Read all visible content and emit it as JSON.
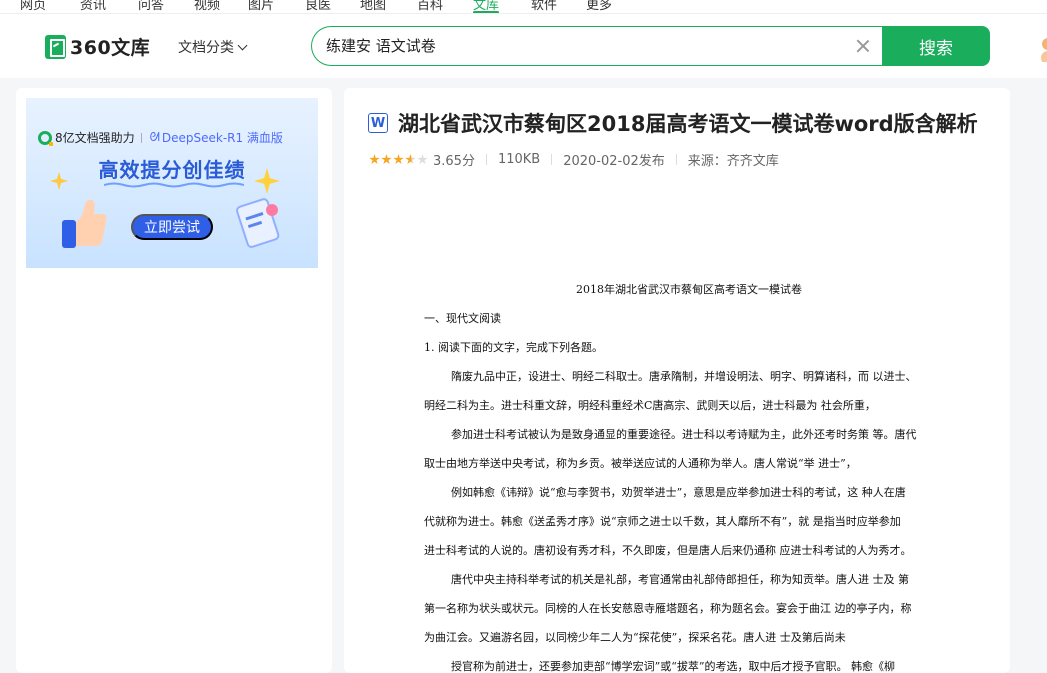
{
  "topnav": {
    "items": [
      "网页",
      "资讯",
      "问答",
      "视频",
      "图片",
      "良医",
      "地图",
      "百科",
      "文库",
      "软件",
      "更多"
    ],
    "active_index": 8
  },
  "header": {
    "logo_text": "360文库",
    "doc_category_label": "文档分类",
    "search_value": "练建安 语文试卷",
    "search_button_label": "搜索"
  },
  "banner": {
    "tagline": "8亿文档强助力",
    "deepseek_label": "DeepSeek-R1 满血版",
    "headline": "高效提分创佳绩",
    "cta_label": "立即尝试"
  },
  "document": {
    "format_icon_letter": "W",
    "title": "湖北省武汉市蔡甸区2018届高考语文一模试卷word版含解析",
    "rating": 3.65,
    "rating_text": "3.65分",
    "size": "110KB",
    "published": "2020-02-02发布",
    "source": "来源：齐齐文库",
    "lines": [
      "2018年湖北省武汉市蔡甸区高考语文一模试卷",
      "一、现代文阅读",
      "1.  阅读下面的文字，完成下列各题。",
      "隋废九品中正，设进士、明经二科取士。唐承隋制，并增设明法、明字、明算诸科，而 以进士、",
      "明经二科为主。进士科重文辞，明经科重经术C唐高宗、武则天以后，进士科最为 社会所重，",
      "参加进士科考试被认为是致身通显的重要途径。进士科以考诗赋为主，此外还考时务策 等。唐代",
      "取士由地方举送中央考试，称为乡贡。被举送应试的人通称为举人。唐人常说“举 进士”，",
      "例如韩愈《讳辩》说“愈与李贺书，劝贺举进士”，意思是应举参加进士科的考试，这 种人在唐",
      "代就称为进士。韩愈《送孟秀才序》说“京师之进士以千数，其人靡所不有”，就 是指当时应举参加",
      "进士科考试的人说的。唐初设有秀才科，不久即废，但是唐人后来仍通称 应进士科考试的人为秀才。",
      "唐代中央主持科举考试的机关是礼部，考官通常由礼部侍郎担任，称为知贡举。唐人进 士及 第",
      "第一名称为状头或状元。同榜的人在长安慈恩寺雁塔题名，称为题名会。宴会于曲江 边的亭子内，称",
      "为曲江会。又遍游名园，以同榜少年二人为“探花使”，探采名花。唐人进 士及第后尚未",
      "授官称为前进士，还要参加吏部“博学宏词”或“拔萃”的考选，取中后才授予官职。 韩愈《柳"
    ]
  },
  "colors": {
    "brand_green": "#1aad5b",
    "banner_blue": "#2f5fe6",
    "star_gold": "#f5a623"
  }
}
